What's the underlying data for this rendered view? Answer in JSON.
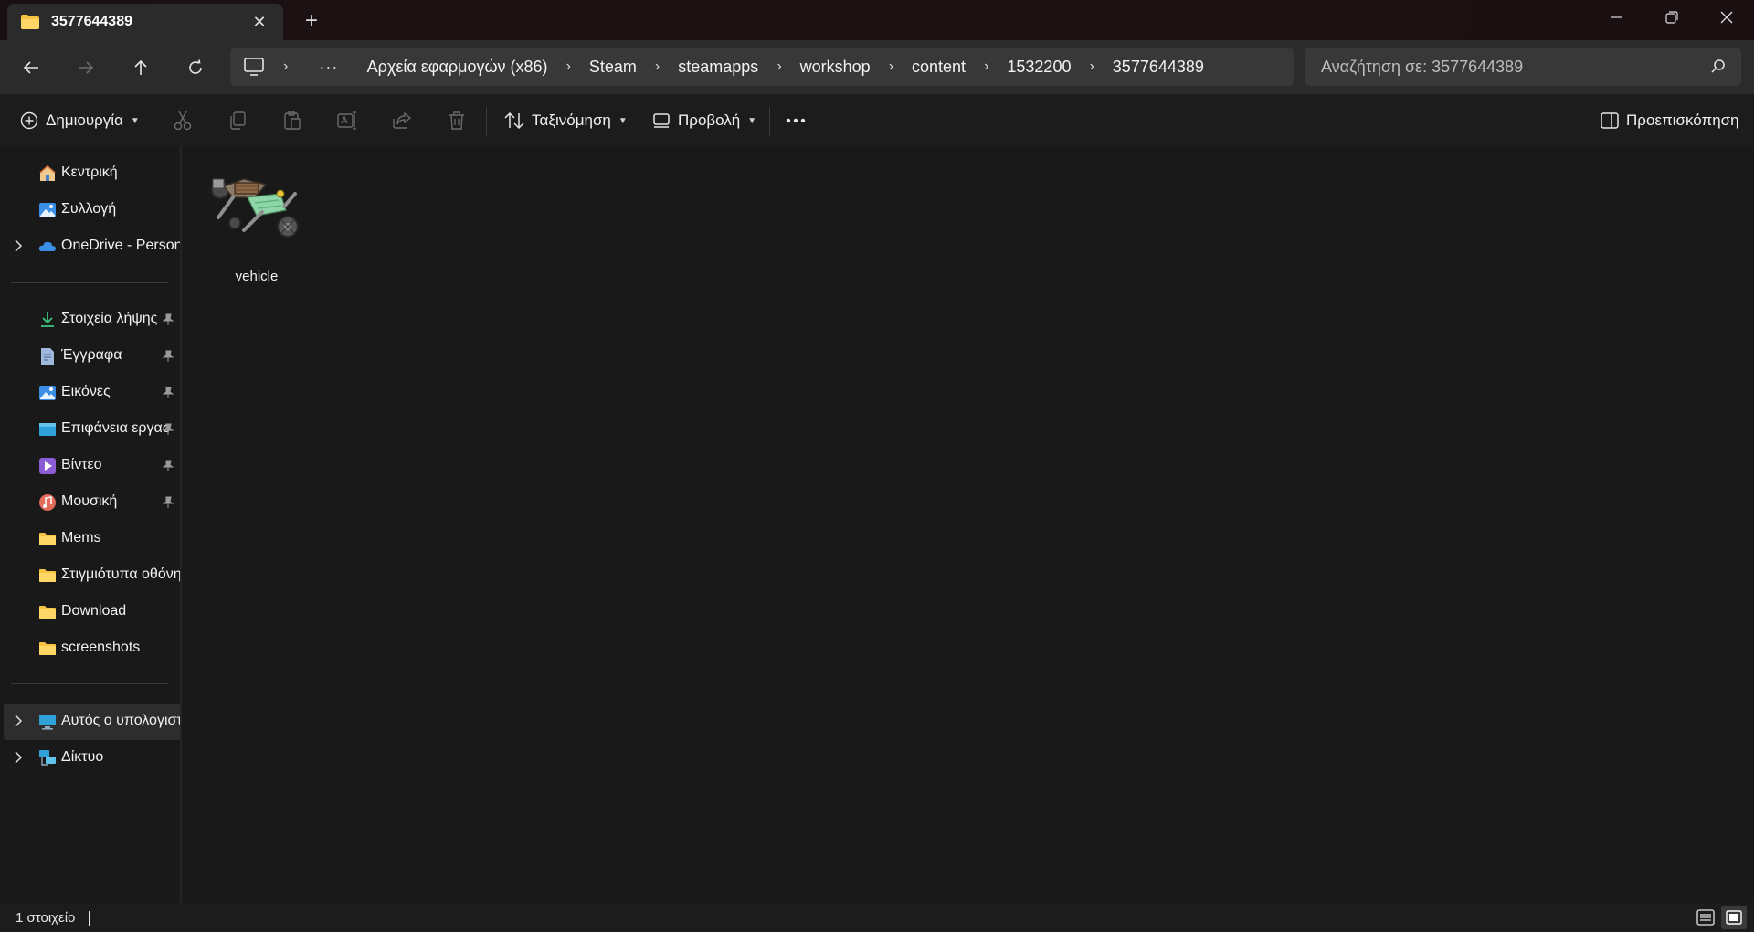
{
  "window": {
    "tab_title": "3577644389",
    "new_tab_icon": "plus-icon",
    "controls": [
      "minimize-icon",
      "restore-icon",
      "close-icon"
    ]
  },
  "address": {
    "crumbs": [
      "Αρχεία εφαρμογών (x86)",
      "Steam",
      "steamapps",
      "workshop",
      "content",
      "1532200",
      "3577644389"
    ],
    "search_placeholder": "Αναζήτηση σε: 3577644389"
  },
  "toolbar": {
    "new_label": "Δημιουργία",
    "sort_label": "Ταξινόμηση",
    "view_label": "Προβολή",
    "preview_label": "Προεπισκόπηση",
    "disabled_icons": [
      "cut-icon",
      "copy-icon",
      "paste-icon",
      "rename-icon",
      "share-icon",
      "delete-icon"
    ]
  },
  "sidebar": {
    "top_items": [
      {
        "label": "Κεντρική",
        "icon": "home-icon"
      },
      {
        "label": "Συλλογή",
        "icon": "gallery-icon"
      },
      {
        "label": "OneDrive - Persona",
        "icon": "onedrive-icon"
      }
    ],
    "quick_access": [
      {
        "label": "Στοιχεία λήψης",
        "icon": "download-icon",
        "pinned": true
      },
      {
        "label": "Έγγραφα",
        "icon": "documents-icon",
        "pinned": true
      },
      {
        "label": "Εικόνες",
        "icon": "pictures-icon",
        "pinned": true
      },
      {
        "label": "Επιφάνεια εργασ",
        "icon": "desktop-icon",
        "pinned": true
      },
      {
        "label": "Βίντεο",
        "icon": "videos-icon",
        "pinned": true
      },
      {
        "label": "Μουσική",
        "icon": "music-icon",
        "pinned": true
      },
      {
        "label": "Mems",
        "icon": "folder-icon",
        "pinned": false
      },
      {
        "label": "Στιγμιότυπα οθόνη",
        "icon": "folder-icon",
        "pinned": false
      },
      {
        "label": "Download",
        "icon": "folder-icon",
        "pinned": false
      },
      {
        "label": "screenshots",
        "icon": "folder-icon",
        "pinned": false
      }
    ],
    "bottom_items": [
      {
        "label": "Αυτός ο υπολογιστ",
        "icon": "this-pc-icon",
        "selected": true
      },
      {
        "label": "Δίκτυο",
        "icon": "network-icon",
        "selected": false
      }
    ]
  },
  "content": {
    "files": [
      {
        "name": "vehicle",
        "icon": "vehicle-thumbnail"
      }
    ]
  },
  "status": {
    "count_text": "1 στοιχείο"
  },
  "colors": {
    "background": "#191919",
    "panel": "#2b2b2b",
    "folder_yellow": "#f5c242",
    "accent_blue": "#3a8ee6"
  }
}
